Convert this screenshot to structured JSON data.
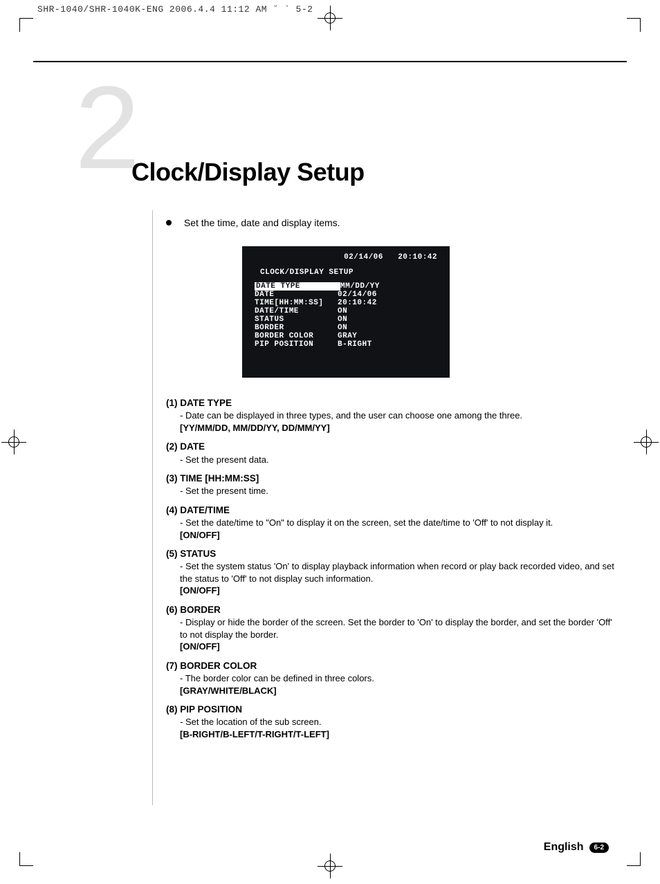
{
  "print_header": "SHR-1040/SHR-1040K-ENG 2006.4.4 11:12 AM  ˘  `  5-2",
  "chapter_number": "2",
  "chapter_title": "Clock/Display Setup",
  "intro_text": "Set the time, date and display items.",
  "osd": {
    "header_date": "02/14/06",
    "header_time": "20:10:42",
    "title": "CLOCK/DISPLAY SETUP",
    "rows": [
      {
        "label": "DATE TYPE",
        "value": "MM/DD/YY",
        "selected": true
      },
      {
        "label": "DATE",
        "value": "02/14/06"
      },
      {
        "label": "TIME[HH:MM:SS]",
        "value": "20:10:42"
      },
      {
        "label": "DATE/TIME",
        "value": "ON"
      },
      {
        "label": "STATUS",
        "value": "ON"
      },
      {
        "label": "BORDER",
        "value": "ON"
      },
      {
        "label": "BORDER COLOR",
        "value": "GRAY"
      },
      {
        "label": "PIP POSITION",
        "value": "B-RIGHT"
      }
    ]
  },
  "items": [
    {
      "head": "(1) DATE TYPE",
      "body": "- Date can be displayed in three types, and the user can choose one among the three.",
      "opt": "[YY/MM/DD, MM/DD/YY, DD/MM/YY]"
    },
    {
      "head": "(2) DATE",
      "body": "- Set the present data.",
      "opt": ""
    },
    {
      "head": "(3) TIME [HH:MM:SS]",
      "body": "- Set the present time.",
      "opt": ""
    },
    {
      "head": "(4) DATE/TIME",
      "body": "- Set the date/time to \"On\" to display it on the screen, set the date/time to 'Off' to not display it.",
      "opt": "[ON/OFF]"
    },
    {
      "head": "(5) STATUS",
      "body": "- Set the system status 'On' to display playback information when record or play back recorded video, and set the status to 'Off' to not display such information.",
      "opt": "[ON/OFF]"
    },
    {
      "head": "(6) BORDER",
      "body": "- Display or hide the border of the screen. Set the border to 'On' to display the border, and set the border 'Off' to not display the border.",
      "opt": "[ON/OFF]"
    },
    {
      "head": "(7) BORDER COLOR",
      "body": "- The border color can be defined in three colors.",
      "opt": "[GRAY/WHITE/BLACK]"
    },
    {
      "head": "(8) PIP POSITION",
      "body": "- Set the location of the sub screen.",
      "opt": "[B-RIGHT/B-LEFT/T-RIGHT/T-LEFT]"
    }
  ],
  "footer": {
    "language": "English",
    "page_badge": "6-2"
  }
}
